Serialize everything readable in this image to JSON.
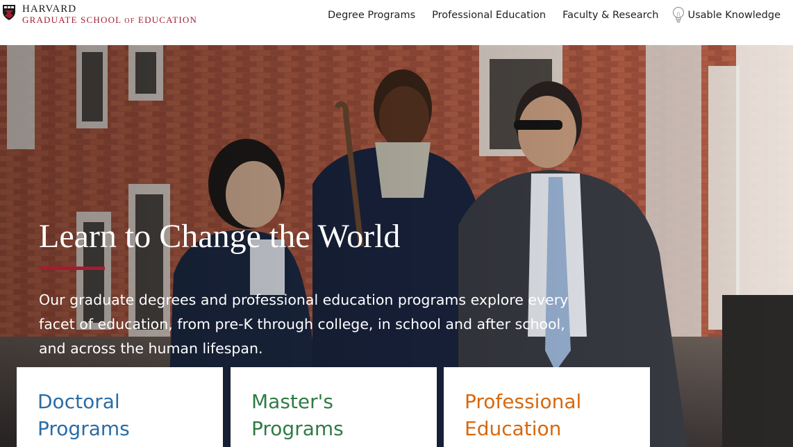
{
  "header": {
    "logo_top": "HARVARD",
    "logo_bottom_1": "GRADUATE SCHOOL",
    "logo_bottom_of": "OF",
    "logo_bottom_2": "EDUCATION",
    "nav": [
      {
        "label": "Degree Programs"
      },
      {
        "label": "Professional Education"
      },
      {
        "label": "Faculty & Research"
      },
      {
        "label": "Usable Knowledge",
        "icon": "lightbulb-icon"
      }
    ]
  },
  "hero": {
    "title": "Learn to Change the World",
    "description": "Our graduate degrees and professional education programs explore every facet of education, from pre-K through college, in school and after school, and across the human lifespan."
  },
  "cards": [
    {
      "label": "Doctoral Programs",
      "color": "#2a6ca5"
    },
    {
      "label": "Master's Programs",
      "color": "#2f7b44"
    },
    {
      "label": "Professional Education",
      "color": "#d7680f"
    }
  ],
  "colors": {
    "accent": "#a51c30"
  }
}
